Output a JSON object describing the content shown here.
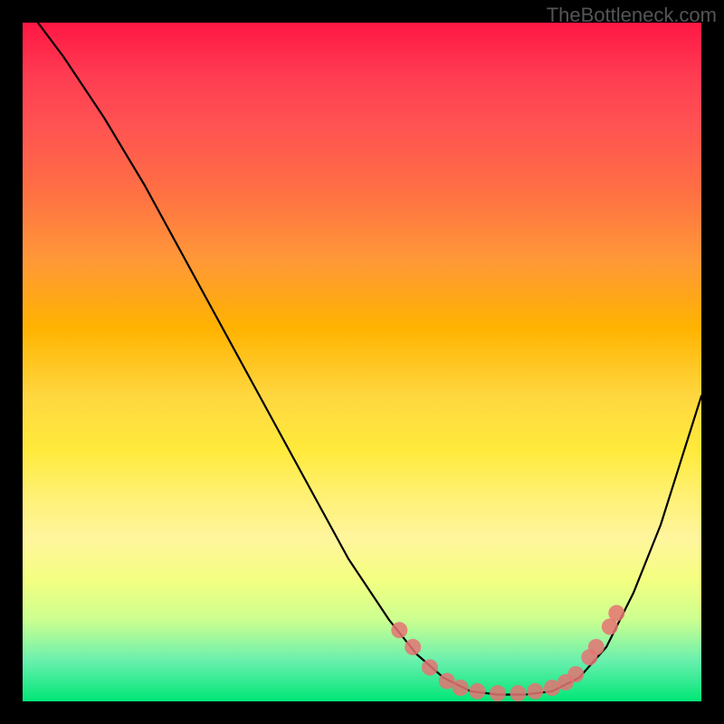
{
  "watermark": "TheBottleneck.com",
  "chart_data": {
    "type": "line",
    "title": "",
    "xlabel": "",
    "ylabel": "",
    "xlim": [
      0,
      100
    ],
    "ylim": [
      0,
      100
    ],
    "series": [
      {
        "name": "bottleneck-curve",
        "x": [
          0,
          6,
          12,
          18,
          24,
          30,
          36,
          42,
          48,
          54,
          58,
          62,
          66,
          70,
          74,
          78,
          82,
          86,
          90,
          94,
          100
        ],
        "y": [
          103,
          95,
          86,
          76,
          65,
          54,
          43,
          32,
          21,
          12,
          7,
          3.5,
          1.5,
          1,
          1,
          1.5,
          3.5,
          8,
          16,
          26,
          45
        ]
      }
    ],
    "markers": {
      "name": "highlighted-points",
      "color": "#e57373",
      "x": [
        55.5,
        57.5,
        60,
        62.5,
        64.5,
        67,
        70,
        73,
        75.5,
        78,
        80,
        81.5,
        83.5,
        84.5,
        86.5,
        87.5
      ],
      "y": [
        10.5,
        8,
        5,
        3,
        2,
        1.5,
        1.2,
        1.2,
        1.5,
        2,
        2.8,
        4,
        6.5,
        8,
        11,
        13
      ]
    },
    "gradient_stops": [
      {
        "pos": 0,
        "color": "#ff1744"
      },
      {
        "pos": 50,
        "color": "#ffd740"
      },
      {
        "pos": 100,
        "color": "#00e676"
      }
    ]
  }
}
